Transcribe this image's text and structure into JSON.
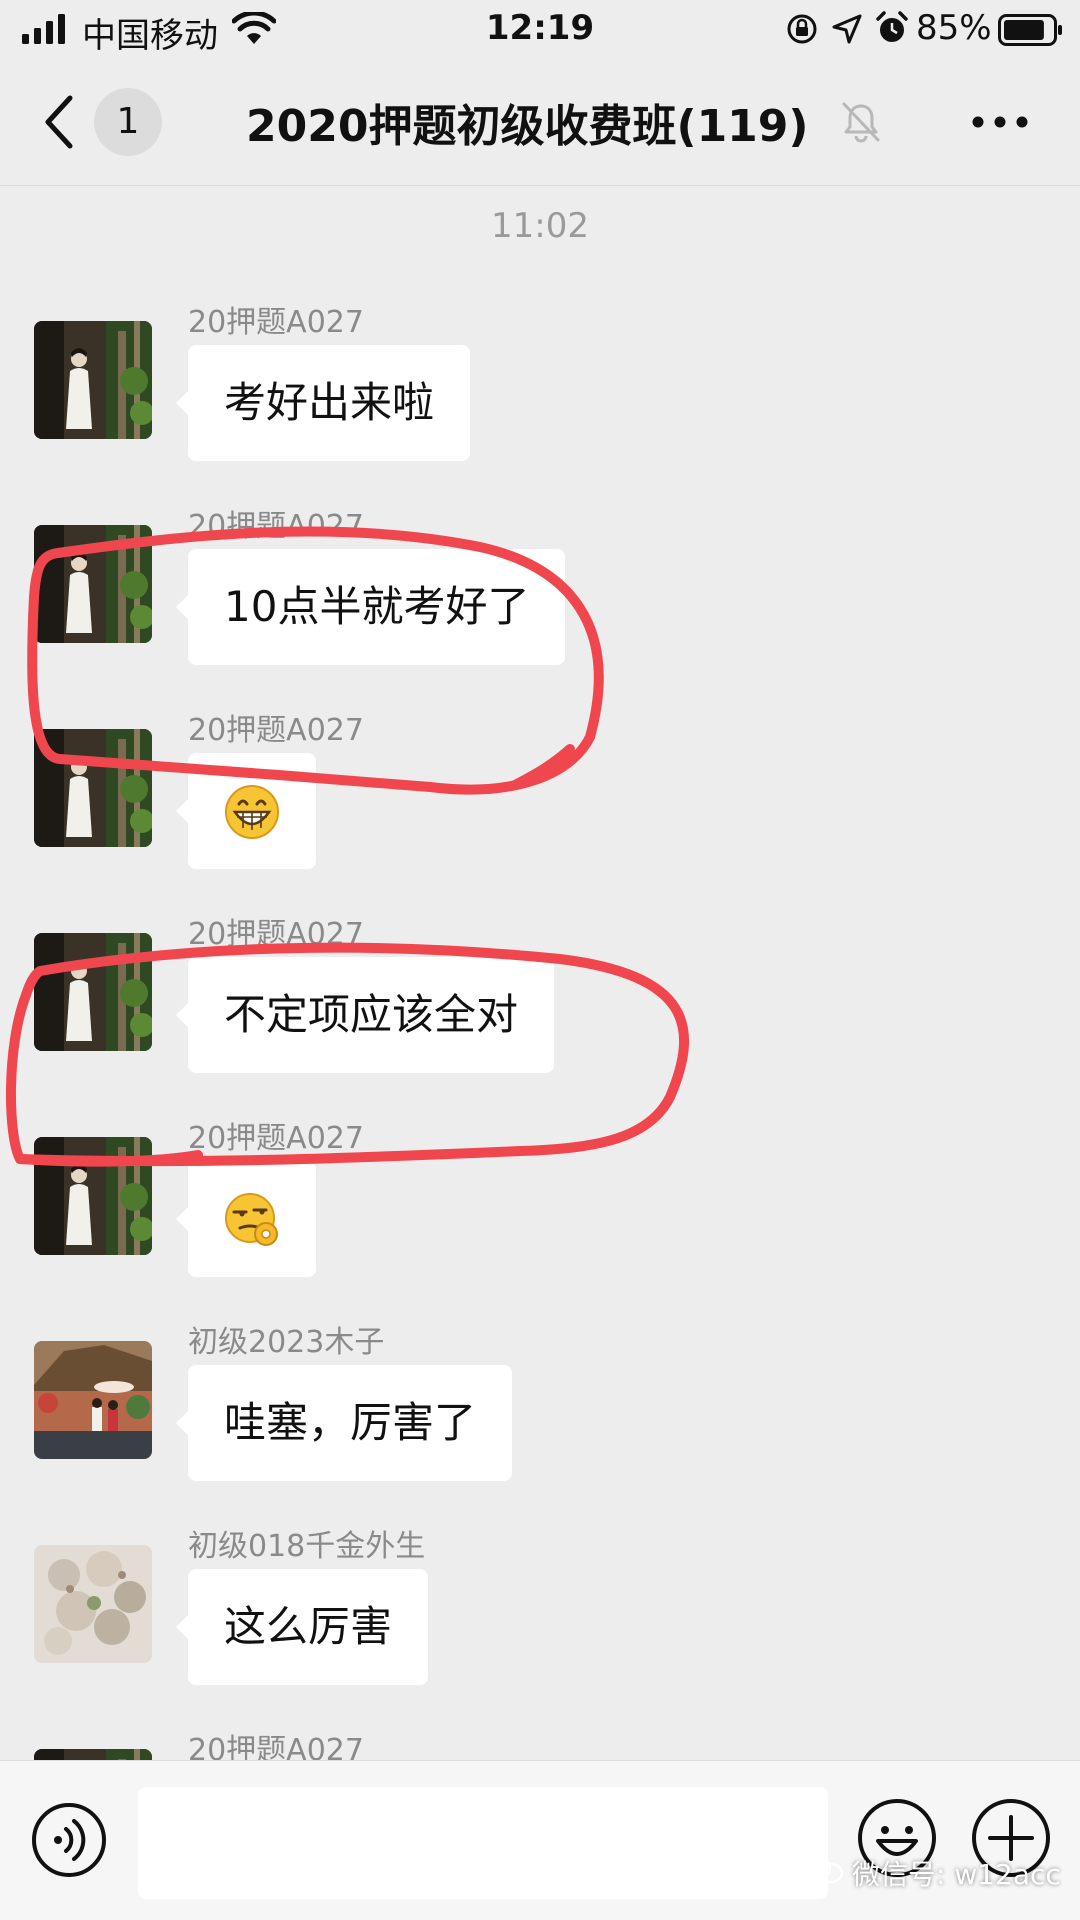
{
  "status_bar": {
    "carrier": "中国移动",
    "time": "12:19",
    "battery_percent": "85%",
    "battery_level": 0.85,
    "icons": [
      "signal-icon",
      "wifi-icon",
      "orientation-lock-icon",
      "location-icon",
      "alarm-icon",
      "battery-icon"
    ]
  },
  "nav": {
    "unread_count": "1",
    "title": "2020押题初级收费班(119)",
    "icons": [
      "back-icon",
      "mute-icon",
      "more-icon"
    ]
  },
  "chat": {
    "time_separator": "11:02",
    "messages": [
      {
        "sender": "20押题A027",
        "text": "考好出来啦",
        "annotated": false
      },
      {
        "sender": "20押题A027",
        "text": "10点半就考好了",
        "annotated": true
      },
      {
        "sender": "20押题A027",
        "emoji": "grinning-face-emoji",
        "annotated": false
      },
      {
        "sender": "20押题A027",
        "text": "不定项应该全对",
        "annotated": true
      },
      {
        "sender": "20押题A027",
        "emoji": "smirk-ok-hand-emoji",
        "annotated": false
      },
      {
        "sender": "初级2023木子",
        "text": "哇塞，厉害了",
        "annotated": false
      },
      {
        "sender": "初级018千金外生",
        "text": "这么厉害",
        "annotated": false
      },
      {
        "sender": "20押题A027"
      }
    ],
    "annotation_color": "#f0474f"
  },
  "input_bar": {
    "input_value": "",
    "icons": [
      "voice-icon",
      "emoji-icon",
      "plus-icon"
    ]
  },
  "watermark": {
    "text": "微信号: w12acc"
  },
  "colors": {
    "background": "#ededed",
    "bubble": "#ffffff",
    "sender_text": "#8a8a8a",
    "annotation": "#f0474f"
  }
}
